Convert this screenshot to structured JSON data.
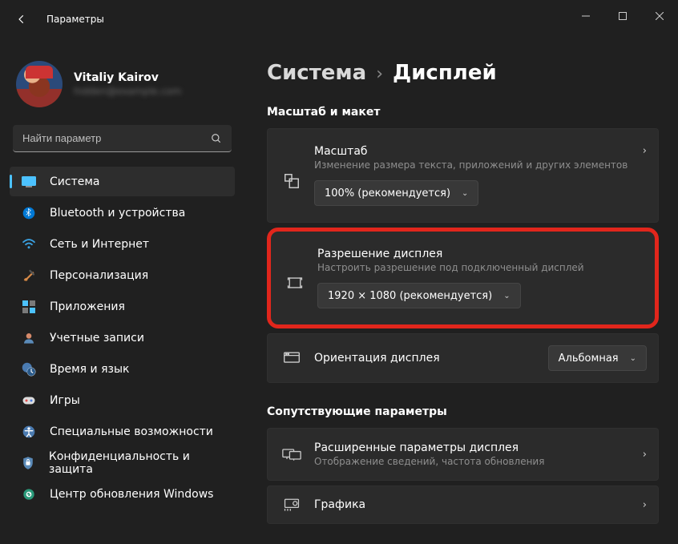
{
  "window": {
    "title": "Параметры"
  },
  "user": {
    "name": "Vitaliy Kairov",
    "email": "hidden@example.com"
  },
  "search": {
    "placeholder": "Найти параметр"
  },
  "nav": [
    {
      "label": "Система",
      "icon": "monitor",
      "active": true
    },
    {
      "label": "Bluetooth и устройства",
      "icon": "bluetooth"
    },
    {
      "label": "Сеть и Интернет",
      "icon": "wifi"
    },
    {
      "label": "Персонализация",
      "icon": "brush"
    },
    {
      "label": "Приложения",
      "icon": "apps"
    },
    {
      "label": "Учетные записи",
      "icon": "person"
    },
    {
      "label": "Время и язык",
      "icon": "clock-globe"
    },
    {
      "label": "Игры",
      "icon": "gamepad"
    },
    {
      "label": "Специальные возможности",
      "icon": "accessibility"
    },
    {
      "label": "Конфиденциальность и защита",
      "icon": "shield"
    },
    {
      "label": "Центр обновления Windows",
      "icon": "update"
    }
  ],
  "breadcrumb": {
    "parent": "Система",
    "current": "Дисплей"
  },
  "sections": {
    "scale_layout": {
      "heading": "Масштаб и макет",
      "scale": {
        "title": "Масштаб",
        "sub": "Изменение размера текста, приложений и других элементов",
        "value": "100% (рекомендуется)"
      },
      "resolution": {
        "title": "Разрешение дисплея",
        "sub": "Настроить разрешение под подключенный дисплей",
        "value": "1920 × 1080 (рекомендуется)"
      },
      "orientation": {
        "title": "Ориентация дисплея",
        "value": "Альбомная"
      }
    },
    "related": {
      "heading": "Сопутствующие параметры",
      "advanced": {
        "title": "Расширенные параметры дисплея",
        "sub": "Отображение сведений, частота обновления"
      },
      "graphics": {
        "title": "Графика"
      }
    }
  }
}
